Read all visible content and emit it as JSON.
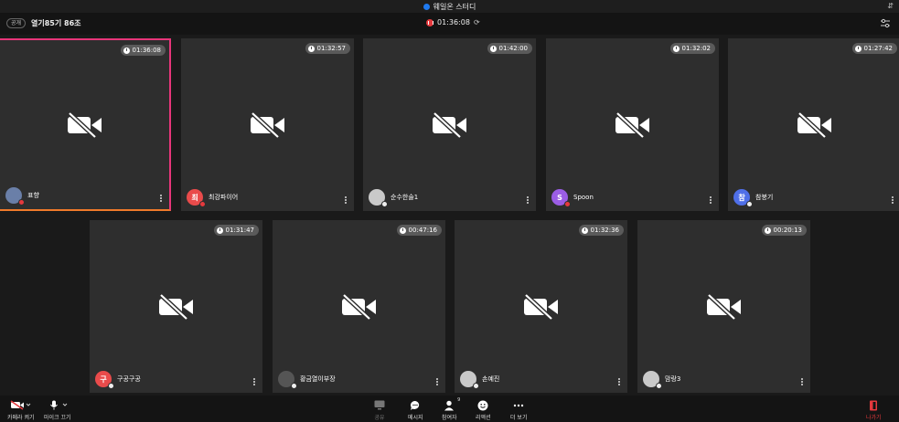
{
  "window": {
    "title": "웨일온 스터디"
  },
  "topbar": {
    "badge": "공개",
    "room": "열기85기 86조",
    "timer": "01:36:08",
    "refresh_glyph": "⟳"
  },
  "participants": [
    {
      "name": "표향",
      "time": "01:36:08",
      "initial": "",
      "avatar_color": "#6a7fa8",
      "active": true,
      "mic": "red"
    },
    {
      "name": "최강파이어",
      "time": "01:32:57",
      "initial": "최",
      "avatar_color": "#e94b4b",
      "mic": "red"
    },
    {
      "name": "순수한술1",
      "time": "01:42:00",
      "initial": "",
      "avatar_color": "#c9c9c9",
      "mic": "white"
    },
    {
      "name": "Spoon",
      "time": "01:32:02",
      "initial": "S",
      "avatar_color": "#9b5de5",
      "mic": "red"
    },
    {
      "name": "참붕기",
      "time": "01:27:42",
      "initial": "참",
      "avatar_color": "#4f6fe8",
      "mic": "white"
    },
    {
      "name": "구공구공",
      "time": "01:31:47",
      "initial": "구",
      "avatar_color": "#e94b4b",
      "mic": "white"
    },
    {
      "name": "황금열이부장",
      "time": "00:47:16",
      "initial": "",
      "avatar_color": "#555555",
      "mic": "white"
    },
    {
      "name": "손예진",
      "time": "01:32:36",
      "initial": "",
      "avatar_color": "#c9c9c9",
      "mic": "white"
    },
    {
      "name": "맘랑3",
      "time": "00:20:13",
      "initial": "",
      "avatar_color": "#c9c9c9",
      "mic": "white"
    }
  ],
  "controls": {
    "camera": "카메라 켜기",
    "mic": "마이크 끄기",
    "share": "공유",
    "message": "메시지",
    "participants": "참여자",
    "participants_count": "9",
    "reaction": "리액션",
    "more": "더 보기",
    "leave": "나가기"
  },
  "colors": {
    "leave": "#e5393d",
    "active_border": "#e8357a",
    "tile_bg": "#2e2e2e"
  }
}
